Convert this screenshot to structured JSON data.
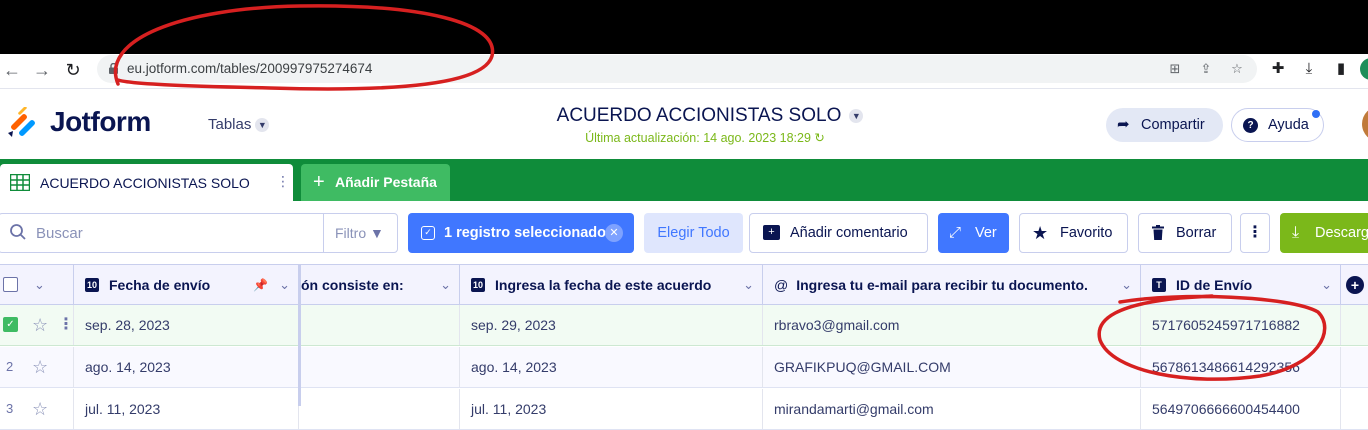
{
  "browser": {
    "url": "eu.jotform.com/tables/200997975274674"
  },
  "app": {
    "brand": "Jotform",
    "tables_menu": "Tablas",
    "doc_title": "ACUERDO ACCIONISTAS SOLO",
    "last_updated": "Última actualización: 14 ago. 2023 18:29",
    "share_label": "Compartir",
    "help_label": "Ayuda"
  },
  "tabs": {
    "active_label": "ACUERDO ACCIONISTAS SOLO",
    "add_label": "Añadir Pestaña"
  },
  "toolbar": {
    "search_placeholder": "Buscar",
    "filter_label": "Filtro",
    "selected_label": "1 registro seleccionado",
    "select_all_label": "Elegir Todo",
    "comment_label": "Añadir comentario",
    "view_label": "Ver",
    "favorite_label": "Favorito",
    "delete_label": "Borrar",
    "download_label": "Descargar"
  },
  "table": {
    "headers": [
      "Fecha de envío",
      "ón consiste en:",
      "Ingresa la fecha de este acuerdo",
      "Ingresa tu e-mail para recibir tu documento.",
      "ID de Envío"
    ],
    "rows": [
      {
        "num": "",
        "fecha": "sep. 28, 2023",
        "col2": "",
        "fecha_acuerdo": "sep. 29, 2023",
        "email": "rbravo3@gmail.com",
        "id": "5717605245971716882"
      },
      {
        "num": "2",
        "fecha": "ago. 14, 2023",
        "col2": "",
        "fecha_acuerdo": "ago. 14, 2023",
        "email": "GRAFIKPUQ@GMAIL.COM",
        "id": "5678613486614292356"
      },
      {
        "num": "3",
        "fecha": "jul. 11, 2023",
        "col2": "",
        "fecha_acuerdo": "jul. 11, 2023",
        "email": "mirandamarti@gmail.com",
        "id": "5649706666600454400"
      }
    ]
  },
  "colors": {
    "brand_navy": "#0a1551",
    "green_tabbar": "#0f8c3a",
    "blue_primary": "#4077ff",
    "annotation_red": "#d62020"
  }
}
